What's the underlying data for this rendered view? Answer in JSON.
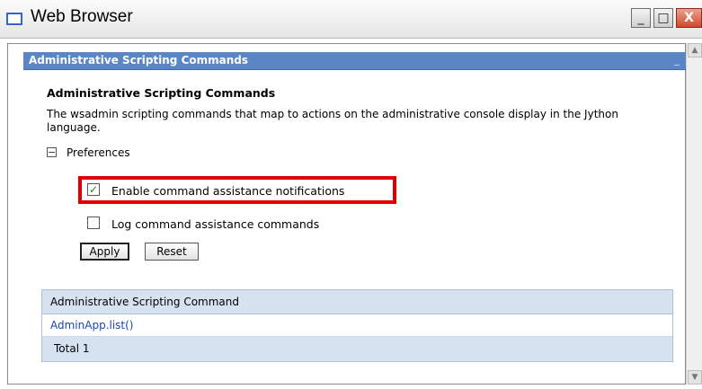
{
  "window": {
    "title": "Web Browser",
    "minimize_glyph": "_",
    "maximize_glyph": "□",
    "close_glyph": "X"
  },
  "portlet": {
    "title": "Administrative Scripting Commands",
    "minimize_glyph": "_"
  },
  "page": {
    "heading": "Administrative Scripting Commands",
    "description": "The wsadmin scripting commands that map to actions on the administrative console display in the Jython language.",
    "preferences": {
      "toggle_glyph": "−",
      "label": "Preferences",
      "options": [
        {
          "label": "Enable command assistance notifications",
          "checked": true
        },
        {
          "label": "Log command assistance commands",
          "checked": false
        }
      ],
      "apply_label": "Apply",
      "reset_label": "Reset"
    },
    "table": {
      "header": "Administrative Scripting Command",
      "rows": [
        "AdminApp.list()"
      ],
      "total": "Total 1"
    }
  },
  "scrollbar": {
    "up_glyph": "▲",
    "down_glyph": "▼"
  },
  "colors": {
    "portlet_bar": "#5a86c5",
    "highlight": "#e00000",
    "link": "#1b45b8",
    "table_header": "#d7e2f1"
  }
}
